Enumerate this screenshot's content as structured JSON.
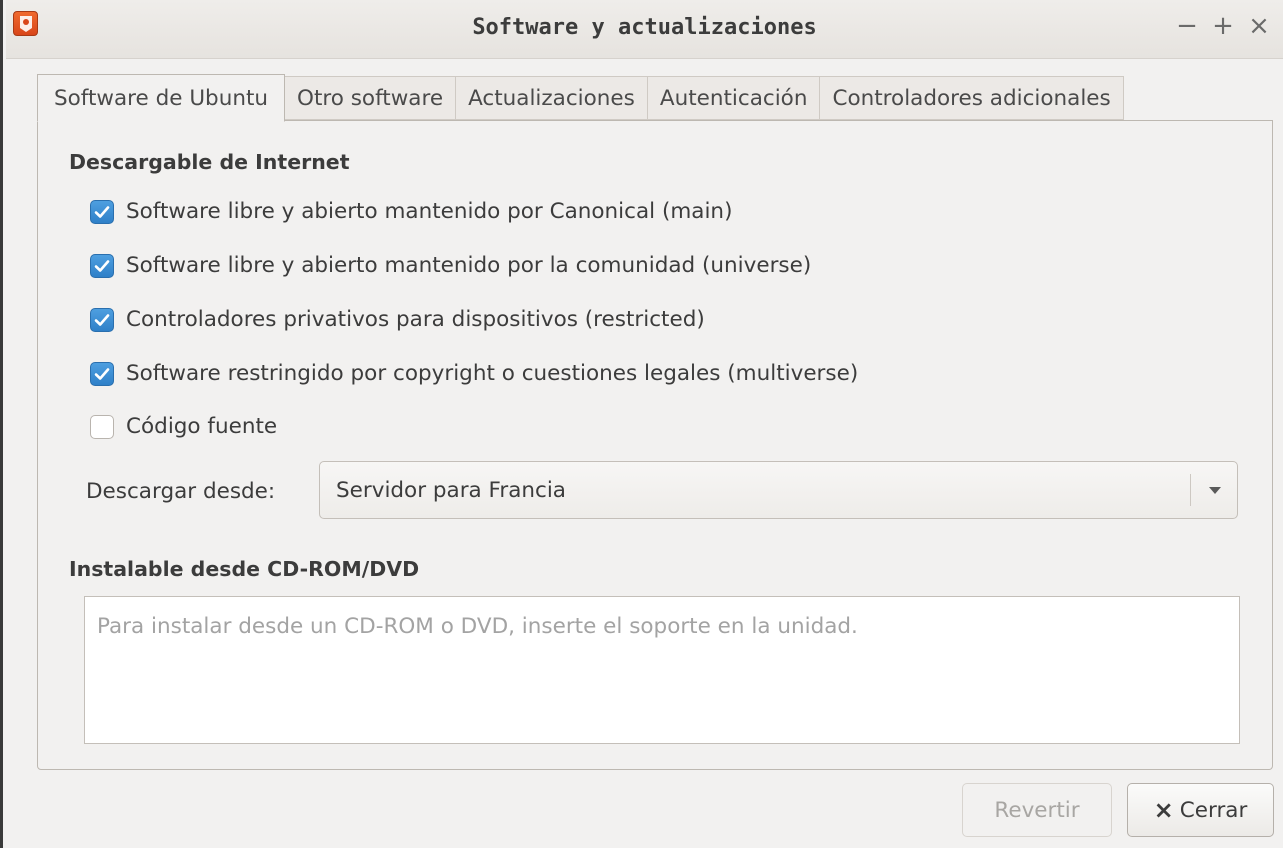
{
  "window": {
    "title": "Software y actualizaciones",
    "controls": {
      "minimize": "−",
      "maximize": "+",
      "close": "×"
    },
    "app_icon": "software-properties-icon"
  },
  "tabs": [
    {
      "label": "Software de Ubuntu",
      "active": true
    },
    {
      "label": "Otro software",
      "active": false
    },
    {
      "label": "Actualizaciones",
      "active": false
    },
    {
      "label": "Autenticación",
      "active": false
    },
    {
      "label": "Controladores adicionales",
      "active": false
    }
  ],
  "internet": {
    "heading": "Descargable de Internet",
    "options": [
      {
        "label": "Software libre y abierto mantenido por Canonical (main)",
        "checked": true
      },
      {
        "label": "Software libre y abierto mantenido por la comunidad (universe)",
        "checked": true
      },
      {
        "label": "Controladores privativos para dispositivos (restricted)",
        "checked": true
      },
      {
        "label": "Software restringido por copyright o cuestiones legales (multiverse)",
        "checked": true
      },
      {
        "label": "Código fuente",
        "checked": false
      }
    ],
    "download_from_label": "Descargar desde:",
    "download_from_value": "Servidor para Francia"
  },
  "cdrom": {
    "heading": "Instalable desde CD-ROM/DVD",
    "message": "Para instalar desde un CD-ROM o DVD, inserte el soporte en la unidad."
  },
  "buttons": {
    "revert_label": "Revertir",
    "close_label": "Cerrar",
    "close_icon": "×"
  },
  "colors": {
    "checkbox_checked": "#3d8fd6",
    "window_bg": "#f2f1f0"
  }
}
